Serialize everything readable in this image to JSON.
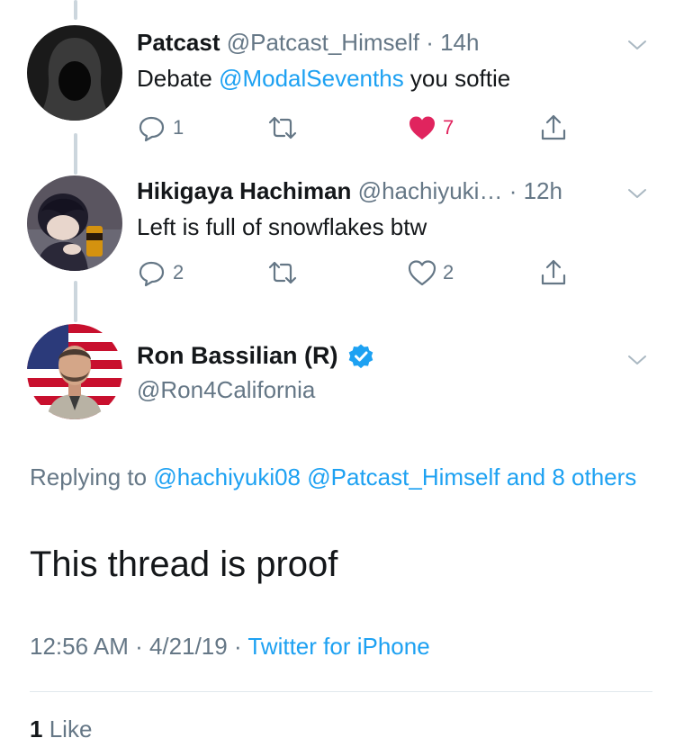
{
  "tweets": [
    {
      "name": "Patcast",
      "handle": "@Patcast_Himself",
      "sep": " · ",
      "time": "14h",
      "text_before": "Debate ",
      "mention": "@ModalSevenths",
      "text_after": " you softie",
      "replies": "1",
      "retweets": "",
      "likes": "7",
      "liked": true,
      "avatar_icon": "hooded-figure"
    },
    {
      "name": "Hikigaya Hachiman",
      "handle": "@hachiyuki…",
      "sep": " · ",
      "time": "12h",
      "text": "Left is full of snowflakes btw",
      "replies": "2",
      "retweets": "",
      "likes": "2",
      "liked": false,
      "avatar_icon": "anime-character"
    }
  ],
  "main_tweet": {
    "name": "Ron Bassilian (R)",
    "handle": "@Ron4California",
    "verified": true,
    "replying_prefix": "Replying to ",
    "replying_to": [
      "@hachiyuki08",
      "@Patcast_Himself"
    ],
    "replying_suffix": "and 8 others",
    "text": "This thread is proof",
    "time": "12:56 AM",
    "date": "4/21/19",
    "sep": " · ",
    "source": "Twitter for iPhone",
    "like_count": "1",
    "like_label": "Like",
    "avatar_icon": "person-flag-background"
  },
  "colors": {
    "link": "#1da1f2",
    "muted": "#657786",
    "like_red": "#e0245e",
    "thread_line": "#ccd6dd"
  }
}
